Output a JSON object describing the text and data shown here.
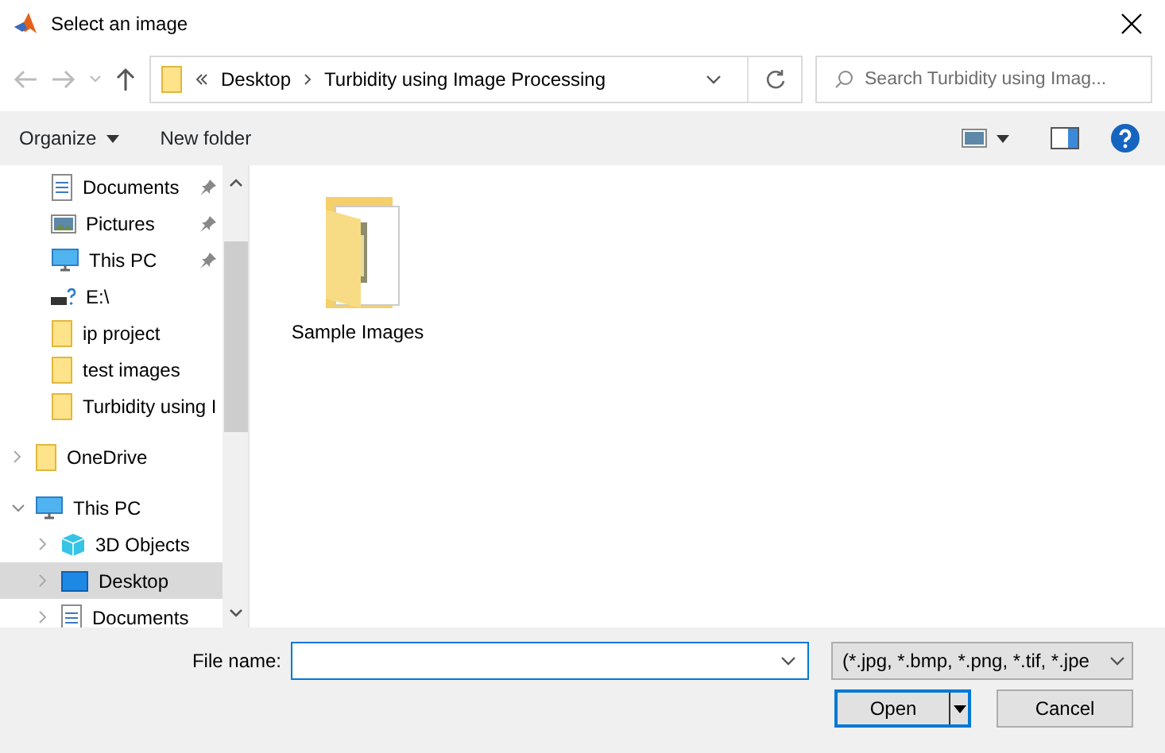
{
  "window": {
    "title": "Select an image"
  },
  "address_bar": {
    "path": [
      {
        "label": "Desktop"
      },
      {
        "label": "Turbidity using Image Processing"
      }
    ]
  },
  "search": {
    "placeholder": "Search Turbidity using Imag..."
  },
  "toolbar": {
    "organize": "Organize",
    "new_folder": "New folder"
  },
  "quick_access": [
    {
      "label": "Documents",
      "kind": "documents",
      "pinned": true
    },
    {
      "label": "Pictures",
      "kind": "pictures",
      "pinned": true
    },
    {
      "label": "This PC",
      "kind": "pc",
      "pinned": true
    },
    {
      "label": "E:\\",
      "kind": "drive",
      "pinned": false
    },
    {
      "label": "ip project",
      "kind": "folder",
      "pinned": false
    },
    {
      "label": "test images",
      "kind": "folder",
      "pinned": false
    },
    {
      "label": "Turbidity using I",
      "kind": "folder",
      "pinned": false
    }
  ],
  "tree": [
    {
      "label": "OneDrive",
      "kind": "folder",
      "expanded": false,
      "selected": false
    },
    {
      "label": "This PC",
      "kind": "pc",
      "expanded": true,
      "selected": false,
      "children": [
        {
          "label": "3D Objects",
          "kind": "cube",
          "expanded": false,
          "selected": false
        },
        {
          "label": "Desktop",
          "kind": "desktop",
          "expanded": false,
          "selected": true
        },
        {
          "label": "Documents",
          "kind": "documents",
          "expanded": false,
          "selected": false
        }
      ]
    }
  ],
  "files": [
    {
      "name": "Sample Images"
    }
  ],
  "file_name": {
    "label": "File name:"
  },
  "file_type": {
    "value": "(*.jpg, *.bmp, *.png, *.tif, *.jpe"
  },
  "buttons": [
    {
      "label": "Open",
      "kind": "split"
    },
    {
      "label": "Cancel",
      "kind": "plain"
    }
  ]
}
